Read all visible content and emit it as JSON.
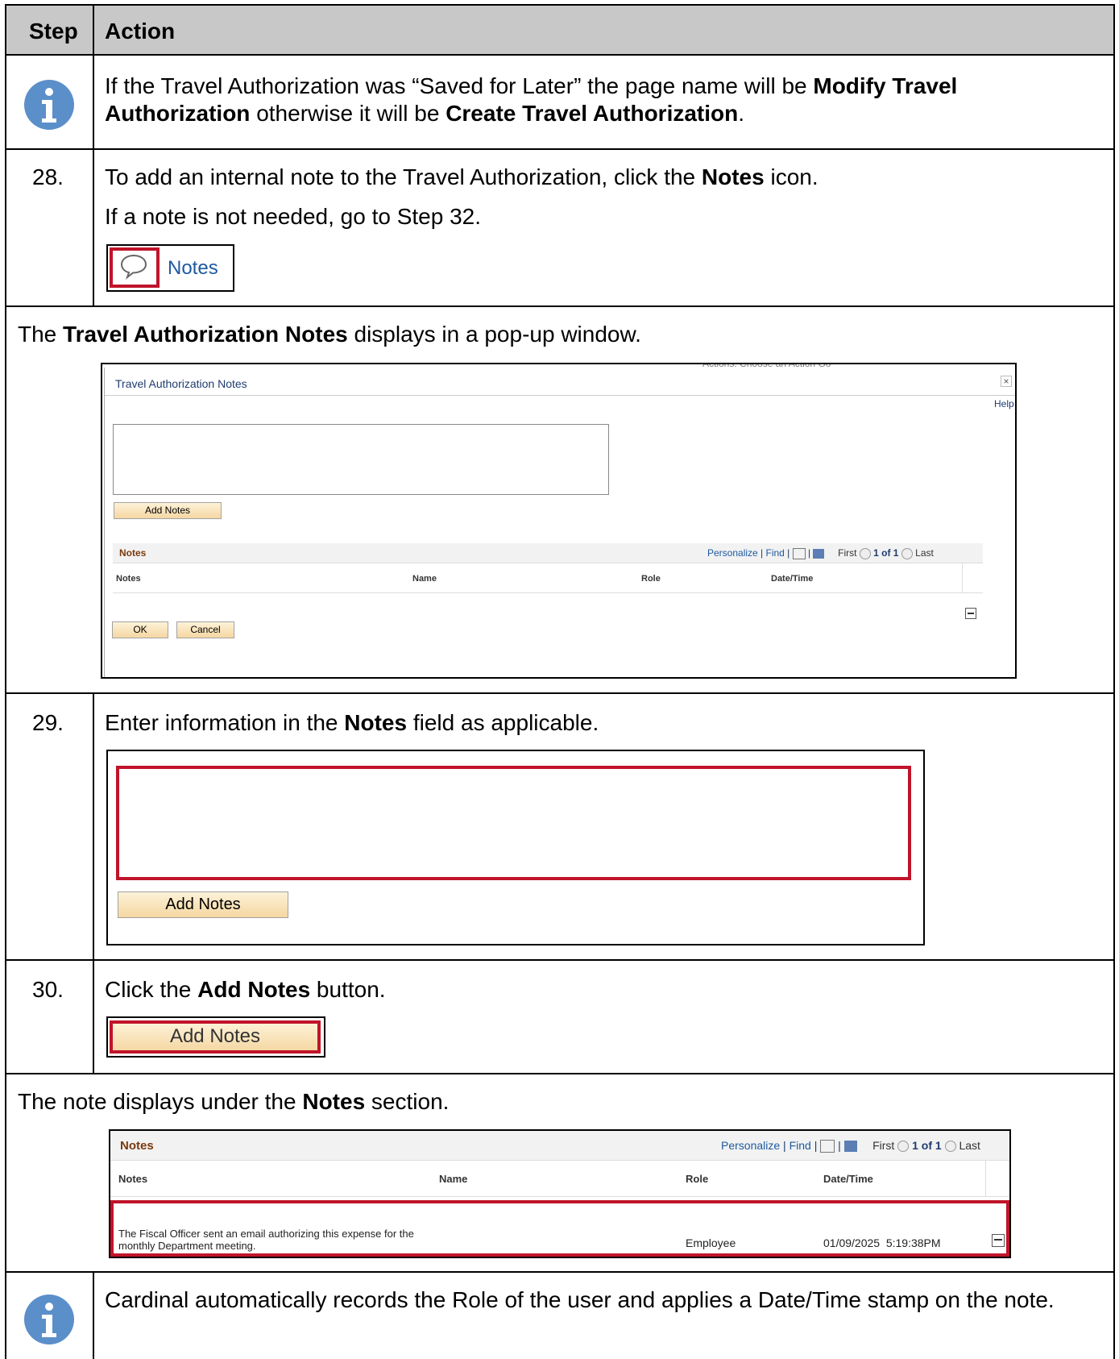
{
  "table": {
    "header_step": "Step",
    "header_action": "Action"
  },
  "row_info1": {
    "icon": "info-icon",
    "t1": "If the Travel Authorization was “Saved for Later” the page name will be ",
    "b1": "Modify Travel Authorization",
    "t2": " otherwise it will be ",
    "b2": "Create Travel Authorization",
    "t3": "."
  },
  "row28": {
    "step": "28.",
    "t1": "To add an internal note to the Travel Authorization, click the ",
    "b1": "Notes",
    "t2": " icon.",
    "line2": "If a note is not needed, go to Step 32.",
    "notes_link": "Notes",
    "icon": "speech-bubble-icon"
  },
  "row_popup": {
    "t1": "The ",
    "b1": "Travel Authorization Notes",
    "t2": " displays in a pop-up window.",
    "behind_label": "Actions:",
    "behind_select": "Choose an Action",
    "behind_go": "Go",
    "window_title": "Travel Authorization Notes",
    "close": "×",
    "help": "Help",
    "add_notes": "Add Notes",
    "grid_title": "Notes",
    "personalize": "Personalize",
    "find": "Find",
    "first": "First",
    "count": "1 of 1",
    "last": "Last",
    "col_notes": "Notes",
    "col_name": "Name",
    "col_role": "Role",
    "col_datetime": "Date/Time",
    "ok": "OK",
    "cancel": "Cancel"
  },
  "row29": {
    "step": "29.",
    "t1": "Enter information in the ",
    "b1": "Notes",
    "t2": " field as applicable.",
    "add_notes": "Add Notes"
  },
  "row30": {
    "step": "30.",
    "t1": "Click the ",
    "b1": "Add Notes",
    "t2": " button.",
    "add_notes": "Add Notes"
  },
  "row_result": {
    "t1": "The note displays under the ",
    "b1": "Notes",
    "t2": " section.",
    "grid_title": "Notes",
    "personalize": "Personalize",
    "find": "Find",
    "first": "First",
    "count": "1 of 1",
    "last": "Last",
    "col_notes": "Notes",
    "col_name": "Name",
    "col_role": "Role",
    "col_datetime": "Date/Time",
    "note_text": "The Fiscal Officer sent an email authorizing this expense for the monthly Department meeting.",
    "role": "Employee",
    "datetime": "01/09/2025  5:19:38PM"
  },
  "row_info2": {
    "icon": "info-icon",
    "text": "Cardinal automatically records the Role of the user and applies a Date/Time stamp on the note."
  },
  "colors": {
    "header_bg": "#c8c8c8",
    "highlight_red": "#c0142a",
    "info_blue": "#5b8fc9",
    "link_blue": "#1e5aa0",
    "button_tan": "#f5d7a2"
  }
}
